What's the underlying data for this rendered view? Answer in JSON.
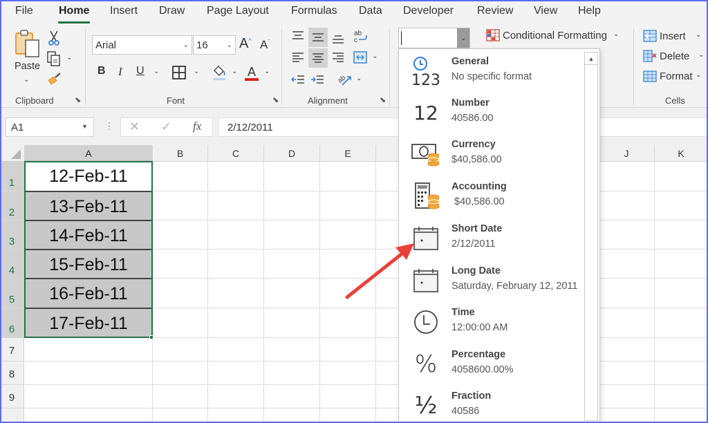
{
  "tabs": [
    "File",
    "Home",
    "Insert",
    "Draw",
    "Page Layout",
    "Formulas",
    "Data",
    "Developer",
    "Review",
    "View",
    "Help"
  ],
  "active_tab": "Home",
  "ribbon": {
    "clipboard": {
      "label": "Clipboard",
      "paste": "Paste"
    },
    "font": {
      "label": "Font",
      "font_name": "Arial",
      "font_size": "16",
      "bold": "B",
      "italic": "I",
      "underline": "U",
      "font_color": "A",
      "grow": "A",
      "shrink": "A"
    },
    "alignment": {
      "label": "Alignment"
    },
    "number": {
      "format_value": ""
    },
    "styles": {
      "conditional_formatting": "Conditional Formatting"
    },
    "cells": {
      "label": "Cells",
      "insert": "Insert",
      "delete": "Delete",
      "format": "Format"
    }
  },
  "formula_bar": {
    "name_box": "A1",
    "cancel": "✕",
    "enter": "✓",
    "fx": "fx",
    "formula": "2/12/2011"
  },
  "columns": [
    "A",
    "B",
    "C",
    "D",
    "E",
    "J",
    "K"
  ],
  "rows": [
    "1",
    "2",
    "3",
    "4",
    "5",
    "6",
    "7",
    "8",
    "9"
  ],
  "cells": [
    "12-Feb-11",
    "13-Feb-11",
    "14-Feb-11",
    "15-Feb-11",
    "16-Feb-11",
    "17-Feb-11"
  ],
  "number_formats": [
    {
      "icon": "general-icon",
      "name": "General",
      "sample": "No specific format"
    },
    {
      "icon": "number-icon",
      "name": "Number",
      "sample": "40586.00"
    },
    {
      "icon": "currency-icon",
      "name": "Currency",
      "sample": "$40,586.00"
    },
    {
      "icon": "accounting-icon",
      "name": "Accounting",
      "sample": " $40,586.00"
    },
    {
      "icon": "short-date-icon",
      "name": "Short Date",
      "sample": "2/12/2011"
    },
    {
      "icon": "long-date-icon",
      "name": "Long Date",
      "sample": "Saturday, February 12, 2011"
    },
    {
      "icon": "time-icon",
      "name": "Time",
      "sample": "12:00:00 AM"
    },
    {
      "icon": "percentage-icon",
      "name": "Percentage",
      "sample": "4058600.00%"
    },
    {
      "icon": "fraction-icon",
      "name": "Fraction",
      "sample": "40586"
    }
  ],
  "icon_glyphs": {
    "general": "123",
    "number": "12",
    "percentage": "%",
    "fraction": "½"
  },
  "colors": {
    "excel_green": "#217346",
    "arrow_red": "#e8413c",
    "selection_fill": "#c8c8c8"
  }
}
